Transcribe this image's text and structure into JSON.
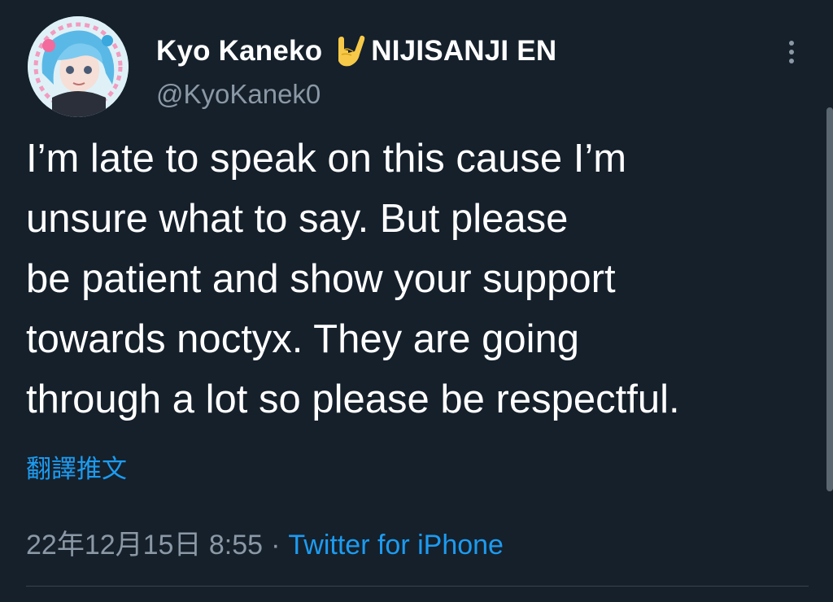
{
  "profile": {
    "display_name": "Kyo Kaneko",
    "badge_text": "NIJISANJI EN",
    "handle": "@KyoKanek0",
    "avatar_icon": "avatar-image",
    "name_emoji_icon": "sign-of-the-horns-emoji-icon"
  },
  "tweet": {
    "lines": [
      "I’m late to speak on this cause I’m",
      "unsure what to say. But please",
      "be patient and show your support",
      "towards noctyx. They are going",
      "through a lot so please be respectful."
    ],
    "translate_label": "翻譯推文",
    "timestamp": "22年12月15日 8:55",
    "separator": "·",
    "source": "Twitter for iPhone"
  },
  "colors": {
    "background": "#15202b",
    "primary_text": "#ffffff",
    "secondary_text": "#8b98a5",
    "accent": "#1d9bf0",
    "divider": "#38444d"
  },
  "icons": {
    "more": "more-vertical-icon"
  }
}
